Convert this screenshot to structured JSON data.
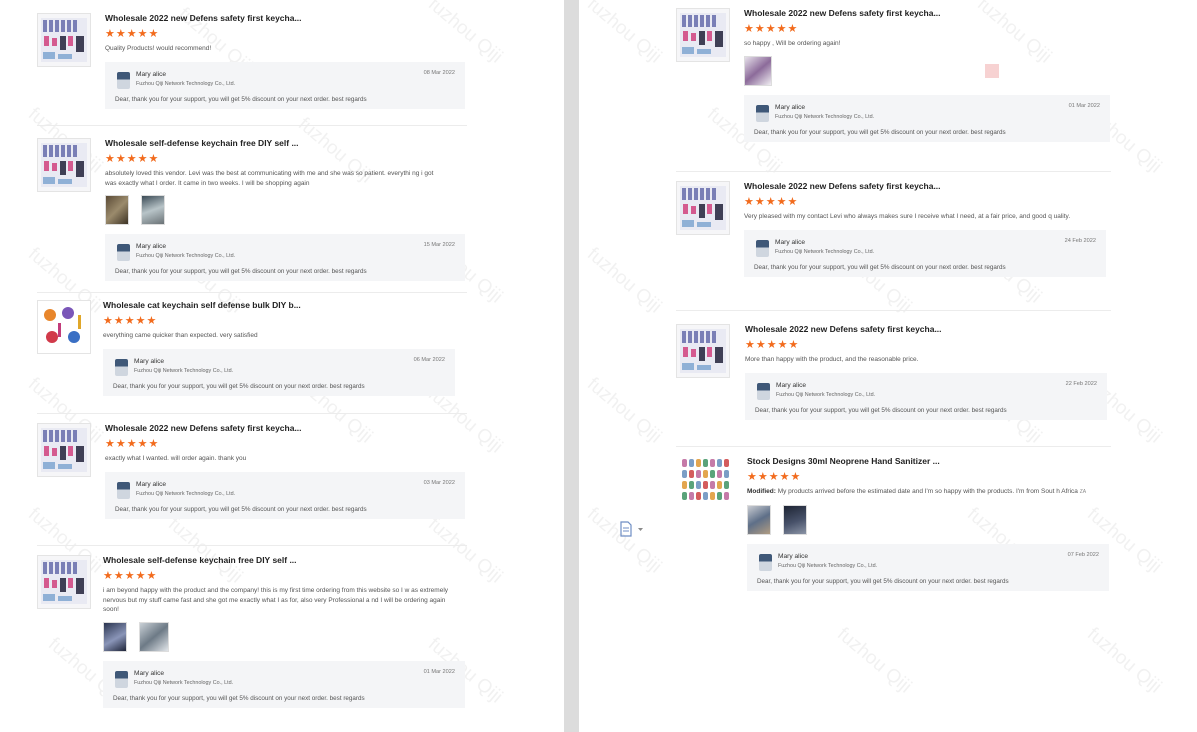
{
  "watermark": "fuzhou Qiji",
  "reply_template": {
    "name": "Mary alice",
    "company": "Fuzhou Qiji Network Technology Co., Ltd.",
    "text": "Dear, thank you for your support, you will get 5% discount on your next order. best regards"
  },
  "stars": "★★★★★",
  "left_reviews": [
    {
      "title": "Wholesale 2022 new Defens safety first keycha...",
      "text": "Quality Products! would recommend!",
      "date": "08 Mar 2022"
    },
    {
      "title": "Wholesale self-defense keychain free DIY self ...",
      "text": "absolutely loved this vendor. Levi was the best at communicating with me and she was so patient. everythi ng i got was exactly what I order. It came in two weeks. I will be shopping again",
      "date": "15 Mar 2022"
    },
    {
      "title": "Wholesale cat keychain self defense bulk DIY b...",
      "text": "everything came quicker than expected. very satisfied",
      "date": "06 Mar 2022"
    },
    {
      "title": "Wholesale 2022 new Defens safety first keycha...",
      "text": "exactly what I wanted.  will order again.  thank you",
      "date": "03 Mar 2022"
    },
    {
      "title": "Wholesale self-defense keychain free DIY self ...",
      "text": "i am beyond happy with the product and the company! this is my first time ordering from this website so I w as extremely nervous but my stuff came fast and she got me exactly what I as for, also very Professional a nd I will be ordering again soon!",
      "date": "01 Mar 2022"
    }
  ],
  "right_reviews": [
    {
      "title": "Wholesale 2022 new Defens safety first keycha...",
      "text": "so happy , Will be ordering again!",
      "date": "01 Mar 2022"
    },
    {
      "title": "Wholesale 2022 new Defens safety first keycha...",
      "text": "Very pleased with my contact Levi who always makes sure I receive what I need, at a fair price, and good q uality.",
      "date": "24 Feb 2022"
    },
    {
      "title": "Wholesale 2022 new Defens safety first keycha...",
      "text": "More than happy with the product, and the reasonable price.",
      "date": "22 Feb 2022"
    },
    {
      "title": "Stock Designs 30ml Neoprene Hand Sanitizer ...",
      "text_label": "Modified:",
      "text": "My products arrived before the estimated date and I'm so happy with the products. I'm from Sout h Africa",
      "translate_mark": "ZA",
      "date": "07 Feb 2022"
    }
  ]
}
